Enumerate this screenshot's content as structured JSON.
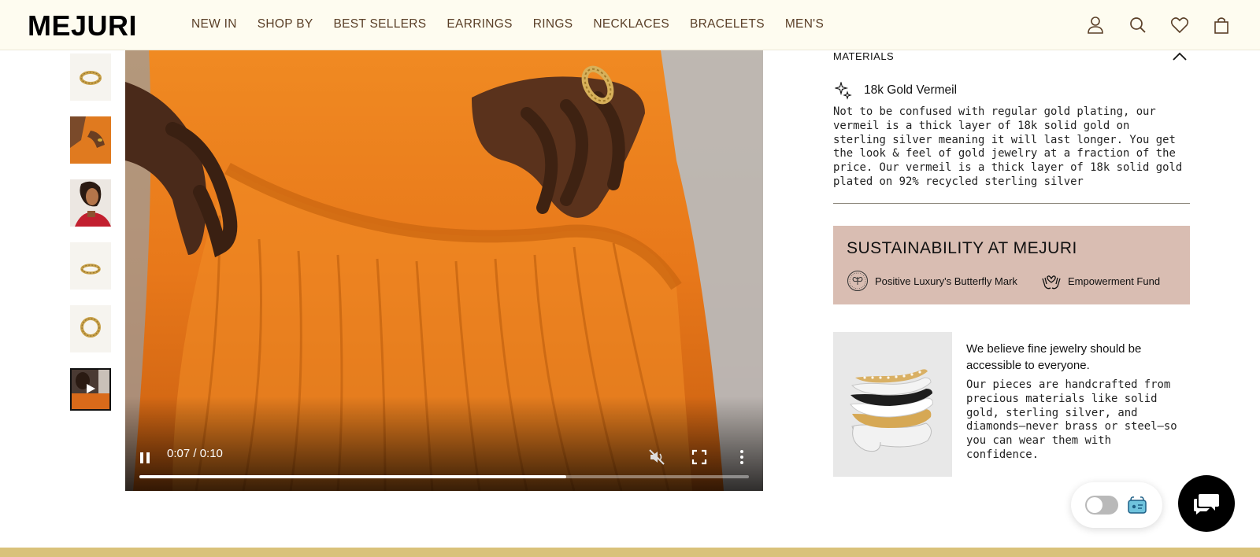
{
  "brand": {
    "logo_text": "MEJURI"
  },
  "nav": {
    "items": [
      "NEW IN",
      "SHOP BY",
      "BEST SELLERS",
      "EARRINGS",
      "RINGS",
      "NECKLACES",
      "BRACELETS",
      "MEN'S"
    ]
  },
  "header_icons": [
    "account-icon",
    "search-icon",
    "wishlist-heart-icon",
    "shopping-bag-icon"
  ],
  "thumbnails": [
    {
      "name": "ring-front-thumbnail"
    },
    {
      "name": "model-orange-hand-thumbnail"
    },
    {
      "name": "model-portrait-thumbnail"
    },
    {
      "name": "ring-side-thumbnail"
    },
    {
      "name": "ring-top-thumbnail"
    },
    {
      "name": "video-thumbnail",
      "has_play_icon": true,
      "active": true
    }
  ],
  "video": {
    "time_display": "0:07 / 0:10",
    "progress_fraction": 0.7,
    "muted": true
  },
  "materials": {
    "heading": "MATERIALS",
    "item_title": "18k Gold Vermeil",
    "description": "Not to be confused with regular gold plating, our vermeil is a thick layer of 18k solid gold on sterling silver meaning it will last longer. You get the look & feel of gold jewelry at a fraction of the price. Our vermeil is a thick layer of 18k solid gold plated on 92% recycled sterling silver"
  },
  "sustainability": {
    "heading": "SUSTAINABILITY AT MEJURI",
    "items": [
      {
        "icon": "butterfly-mark-icon",
        "label": "Positive Luxury's Butterfly Mark"
      },
      {
        "icon": "hands-heart-icon",
        "label": "Empowerment Fund"
      }
    ]
  },
  "promo": {
    "title": "We believe fine jewelry should be accessible to everyone.",
    "description": "Our pieces are handcrafted from precious materials like solid gold, sterling silver, and diamonds—never brass or steel—so you can wear them with confidence."
  },
  "colors": {
    "header_bg": "#fefcf0",
    "nav_text": "#5a3f27",
    "sustain_bg": "#d9bdb2",
    "footer_strip": "#d9c27a",
    "video_bg": "#e87a14"
  }
}
